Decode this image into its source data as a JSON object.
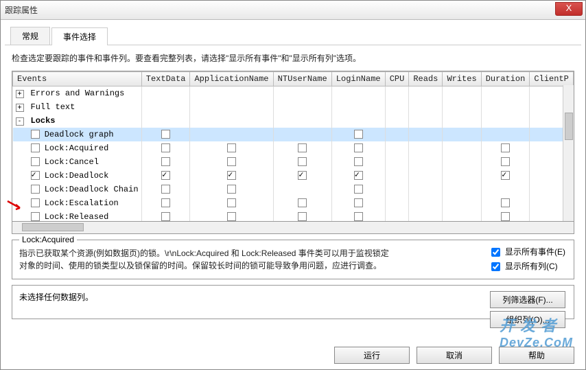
{
  "window": {
    "title": "跟踪属性",
    "close_icon": "X"
  },
  "tabs": {
    "general": "常规",
    "events": "事件选择"
  },
  "instruction": "检查选定要跟踪的事件和事件列。要查看完整列表，请选择\"显示所有事件\"和\"显示所有列\"选项。",
  "columns": [
    "Events",
    "TextData",
    "ApplicationName",
    "NTUserName",
    "LoginName",
    "CPU",
    "Reads",
    "Writes",
    "Duration",
    "ClientP"
  ],
  "rows": [
    {
      "type": "cat",
      "exp": "+",
      "label": "Errors and Warnings",
      "sel": false
    },
    {
      "type": "cat",
      "exp": "+",
      "label": "Full text",
      "sel": false
    },
    {
      "type": "cat",
      "exp": "-",
      "label": "Locks",
      "sel": false,
      "bold": true
    },
    {
      "type": "evt",
      "label": "Deadlock graph",
      "sel": true,
      "c": {
        "TextData": false,
        "LoginName": false
      }
    },
    {
      "type": "evt",
      "label": "Lock:Acquired",
      "sel": false,
      "c": {
        "TextData": false,
        "ApplicationName": false,
        "NTUserName": false,
        "LoginName": false,
        "Duration": false
      }
    },
    {
      "type": "evt",
      "label": "Lock:Cancel",
      "sel": false,
      "c": {
        "TextData": false,
        "ApplicationName": false,
        "NTUserName": false,
        "LoginName": false,
        "Duration": false
      }
    },
    {
      "type": "evt",
      "label": "Lock:Deadlock",
      "sel": false,
      "checked": true,
      "c": {
        "TextData": true,
        "ApplicationName": true,
        "NTUserName": true,
        "LoginName": true,
        "Duration": true
      }
    },
    {
      "type": "evt",
      "label": "Lock:Deadlock Chain",
      "sel": false,
      "c": {
        "TextData": false,
        "ApplicationName": false,
        "LoginName": false
      }
    },
    {
      "type": "evt",
      "label": "Lock:Escalation",
      "sel": false,
      "c": {
        "TextData": false,
        "ApplicationName": false,
        "NTUserName": false,
        "LoginName": false,
        "Duration": false
      }
    },
    {
      "type": "evt",
      "label": "Lock:Released",
      "sel": false,
      "c": {
        "TextData": false,
        "ApplicationName": false,
        "NTUserName": false,
        "LoginName": false,
        "Duration": false
      }
    }
  ],
  "desc": {
    "legend": "Lock:Acquired",
    "text": "指示已获取某个资源(例如数据页)的锁。\\r\\nLock:Acquired 和 Lock:Released 事件类可以用于监视锁定对象的时间、使用的锁类型以及锁保留的时间。保留较长时间的锁可能导致争用问题，应进行调查。"
  },
  "checks": {
    "show_all_events": {
      "label": "显示所有事件(E)",
      "checked": true
    },
    "show_all_cols": {
      "label": "显示所有列(C)",
      "checked": true
    }
  },
  "nodata": "未选择任何数据列。",
  "buttons": {
    "col_filter": "列筛选器(F)...",
    "organize": "组织列(O)...",
    "run": "运行",
    "cancel": "取消",
    "help": "帮助"
  },
  "watermark": {
    "l1": "开 发 者",
    "l2": "DevZe.CoM"
  }
}
